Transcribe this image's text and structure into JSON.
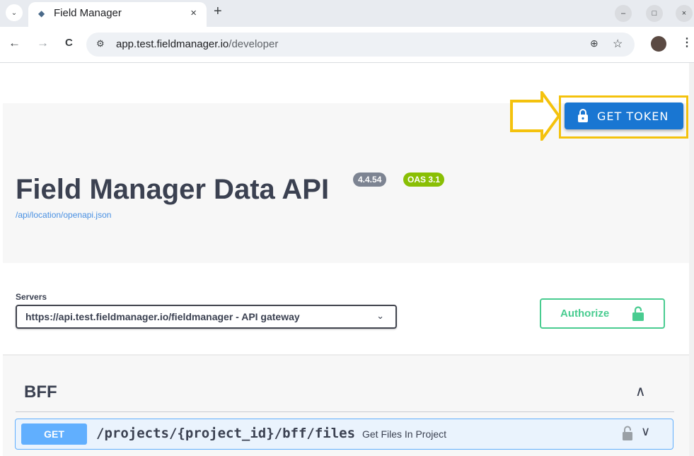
{
  "browser": {
    "tab_title": "Field Manager",
    "tab_close": "×",
    "new_tab": "+",
    "url_host": "app.test.fieldmanager.io",
    "url_path": "/developer",
    "back": "←",
    "forward": "→",
    "reload": "C",
    "site_info": "⚙",
    "zoom": "⊕",
    "star": "☆",
    "menu": "⋮",
    "min": "–",
    "max": "□",
    "close": "×",
    "tab_menu": "⌄"
  },
  "header": {
    "token_button_label": "GET TOKEN",
    "api_title": "Field Manager Data API",
    "version_badge": "4.4.54",
    "oas_badge": "OAS 3.1",
    "spec_link": "/api/location/openapi.json"
  },
  "servers": {
    "label": "Servers",
    "selected": "https://api.test.fieldmanager.io/fieldmanager - API gateway",
    "chevron": "⌄"
  },
  "authorize": {
    "label": "Authorize"
  },
  "section": {
    "title": "BFF",
    "toggle": "∧"
  },
  "operation": {
    "method": "GET",
    "path": "/projects/{project_id}/bff/files",
    "summary": "Get Files In Project",
    "chevron": "∨"
  },
  "colors": {
    "token_button": "#1976d2",
    "highlight": "#f4c20d",
    "authorize": "#49cc90",
    "get_method": "#61affe",
    "oas_badge": "#89bf04"
  }
}
